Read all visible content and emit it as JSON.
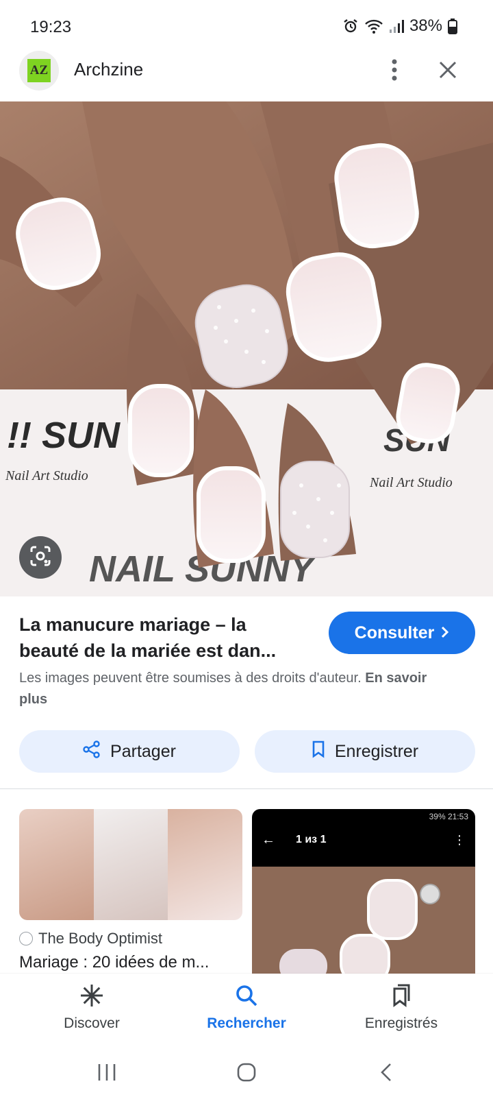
{
  "status_bar": {
    "time": "19:23",
    "battery": "38%",
    "icons": [
      "alarm-icon",
      "wifi-icon",
      "signal-icon",
      "battery-icon"
    ]
  },
  "header": {
    "logo_text": "AZ",
    "site_name": "Archzine",
    "menu_icon": "more-vert-icon",
    "close_icon": "close-icon"
  },
  "image": {
    "lens_icon": "lens-icon",
    "background_text": [
      "NAIL SUNNY",
      "Nail Art Studio"
    ]
  },
  "result": {
    "title_line1": "La manucure mariage – la",
    "title_line2": "beauté de la mariée est dan...",
    "consult_label": "Consulter",
    "copyright_text": "Les images peuvent être soumises à des droits d'auteur.",
    "learn_more": "En savoir plus"
  },
  "actions": {
    "share_label": "Partager",
    "save_label": "Enregistrer"
  },
  "related": [
    {
      "source": "The Body Optimist",
      "title": "Mariage : 20 idées de m..."
    },
    {
      "mini_status": "39% 21:53",
      "mini_title": "1 из 1"
    }
  ],
  "bottom_nav": {
    "items": [
      {
        "label": "Discover",
        "icon": "asterisk-icon"
      },
      {
        "label": "Rechercher",
        "icon": "search-icon"
      },
      {
        "label": "Enregistrés",
        "icon": "collections-icon"
      }
    ],
    "active_color": "#1a73e8"
  },
  "colors": {
    "accent": "#1a73e8",
    "pill_background": "#e8f0fe",
    "logo_green": "#7ed321"
  }
}
